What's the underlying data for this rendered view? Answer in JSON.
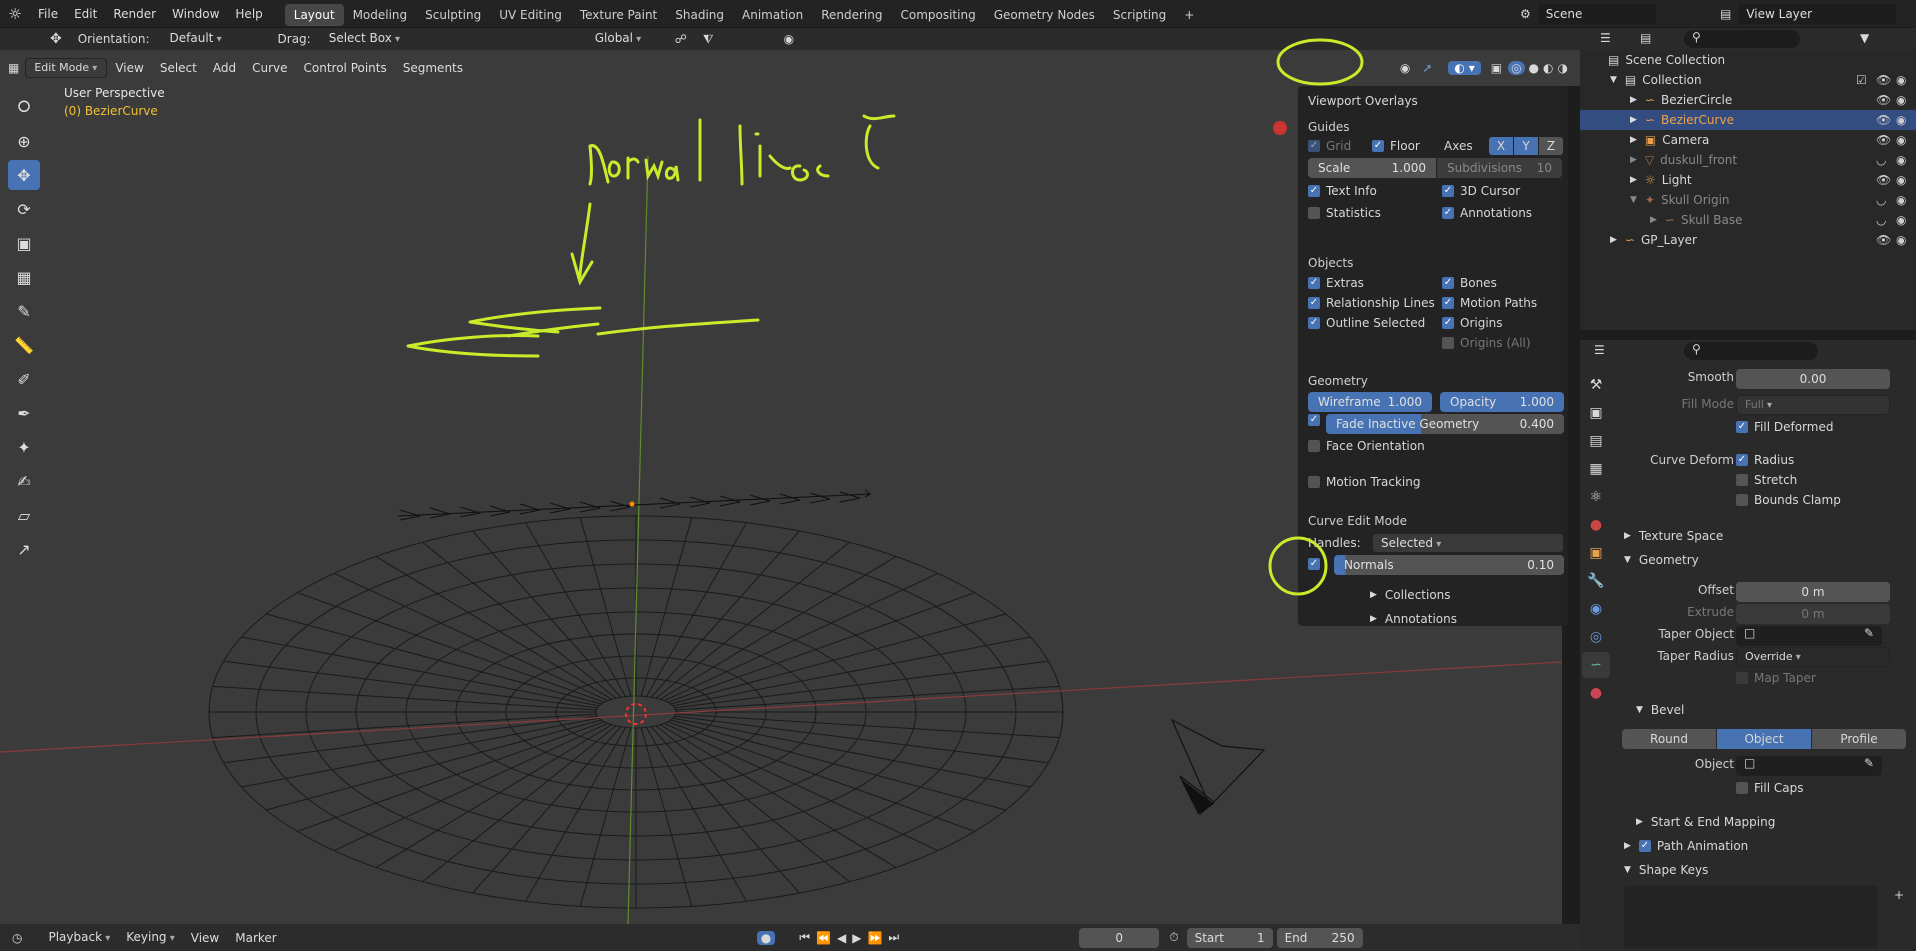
{
  "topbar": {
    "menus": [
      "File",
      "Edit",
      "Render",
      "Window",
      "Help"
    ],
    "workspaces": [
      "Layout",
      "Modeling",
      "Sculpting",
      "UV Editing",
      "Texture Paint",
      "Shading",
      "Animation",
      "Rendering",
      "Compositing",
      "Geometry Nodes",
      "Scripting"
    ],
    "active_workspace": "Layout",
    "add_tab": "+",
    "scene": "Scene",
    "view_layer": "View Layer"
  },
  "header1": {
    "orientation_label": "Orientation:",
    "orientation_value": "Default",
    "drag_label": "Drag:",
    "drag_value": "Select Box",
    "transform": "Global"
  },
  "header2": {
    "mode": "Edit Mode",
    "menus": [
      "View",
      "Select",
      "Add",
      "Curve",
      "Control Points",
      "Segments"
    ]
  },
  "viewport": {
    "perspective": "User Perspective",
    "object": "(0) BezierCurve",
    "annotation": "Normal lines"
  },
  "overlays": {
    "title": "Viewport Overlays",
    "guides": "Guides",
    "grid": "Grid",
    "floor": "Floor",
    "axes": "Axes",
    "axis_x": "X",
    "axis_y": "Y",
    "axis_z": "Z",
    "scale_label": "Scale",
    "scale_value": "1.000",
    "subdiv_label": "Subdivisions",
    "subdiv_value": "10",
    "text_info": "Text Info",
    "cursor3d": "3D Cursor",
    "statistics": "Statistics",
    "annotations": "Annotations",
    "objects": "Objects",
    "extras": "Extras",
    "bones": "Bones",
    "relationship_lines": "Relationship Lines",
    "motion_paths": "Motion Paths",
    "outline_selected": "Outline Selected",
    "origins": "Origins",
    "origins_all": "Origins (All)",
    "geometry": "Geometry",
    "wireframe_label": "Wireframe",
    "wireframe_value": "1.000",
    "opacity_label": "Opacity",
    "opacity_value": "1.000",
    "fade_label": "Fade Inactive Geometry",
    "fade_value": "0.400",
    "face_orientation": "Face Orientation",
    "motion_tracking": "Motion Tracking",
    "curve_edit": "Curve Edit Mode",
    "handles_label": "Handles:",
    "handles_value": "Selected",
    "normals_label": "Normals",
    "normals_value": "0.10",
    "collections": "Collections",
    "annotations_panel": "Annotations"
  },
  "outliner": {
    "scene_collection": "Scene Collection",
    "items": [
      {
        "name": "Collection",
        "indent": 1
      },
      {
        "name": "BezierCircle",
        "indent": 2
      },
      {
        "name": "BezierCurve",
        "indent": 2
      },
      {
        "name": "Camera",
        "indent": 2
      },
      {
        "name": "duskull_front",
        "indent": 2
      },
      {
        "name": "Light",
        "indent": 2
      },
      {
        "name": "Skull Origin",
        "indent": 2
      },
      {
        "name": "Skull Base",
        "indent": 3
      },
      {
        "name": "GP_Layer",
        "indent": 1
      }
    ]
  },
  "properties": {
    "smooth_label": "Smooth",
    "smooth_value": "0.00",
    "fill_mode_label": "Fill Mode",
    "fill_mode_value": "Full",
    "fill_deformed": "Fill Deformed",
    "curve_deform_label": "Curve Deform",
    "radius": "Radius",
    "stretch": "Stretch",
    "bounds_clamp": "Bounds Clamp",
    "texture_space": "Texture Space",
    "geometry": "Geometry",
    "offset_label": "Offset",
    "offset_value": "0 m",
    "extrude_label": "Extrude",
    "extrude_value": "0 m",
    "taper_object_label": "Taper Object",
    "taper_radius_label": "Taper Radius",
    "taper_radius_value": "Override",
    "map_taper": "Map Taper",
    "bevel": "Bevel",
    "bevel_modes": [
      "Round",
      "Object",
      "Profile"
    ],
    "object_label": "Object",
    "fill_caps": "Fill Caps",
    "start_end": "Start & End Mapping",
    "path_animation": "Path Animation",
    "shape_keys": "Shape Keys"
  },
  "timeline": {
    "menus": [
      "Playback",
      "Keying",
      "View",
      "Marker"
    ],
    "frame": "0",
    "start_label": "Start",
    "start_value": "1",
    "end_label": "End",
    "end_value": "250"
  }
}
